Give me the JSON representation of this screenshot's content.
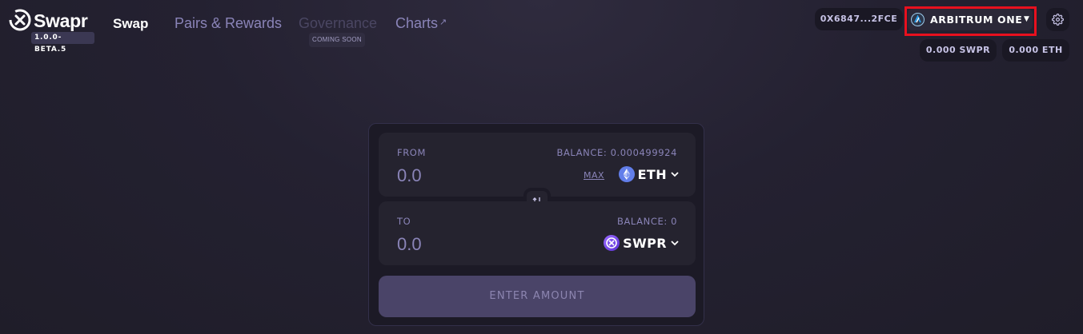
{
  "header": {
    "brand": "Swapr",
    "version": "1.0.0-BETA.5",
    "nav": {
      "swap": "Swap",
      "pairs_rewards": "Pairs & Rewards",
      "governance": "Governance",
      "governance_badge": "COMING SOON",
      "charts": "Charts",
      "charts_arrow": "↗"
    },
    "account": {
      "address": "0X6847...2FCE",
      "network": "ARBITRUM ONE",
      "swpr_balance": "0.000 SWPR",
      "eth_balance": "0.000 ETH"
    }
  },
  "swap": {
    "from": {
      "label": "FROM",
      "balance": "BALANCE: 0.000499924",
      "placeholder": "0.0",
      "max_label": "MAX",
      "token": "ETH",
      "token_icon": "ethereum-icon"
    },
    "to": {
      "label": "TO",
      "balance": "BALANCE: 0",
      "placeholder": "0.0",
      "token": "SWPR",
      "token_icon": "swpr-icon"
    },
    "submit_label": "ENTER AMOUNT"
  },
  "colors": {
    "background": "#24212f",
    "accent": "#8a84b8",
    "highlight": "#e8101e",
    "button": "#4a4468"
  }
}
